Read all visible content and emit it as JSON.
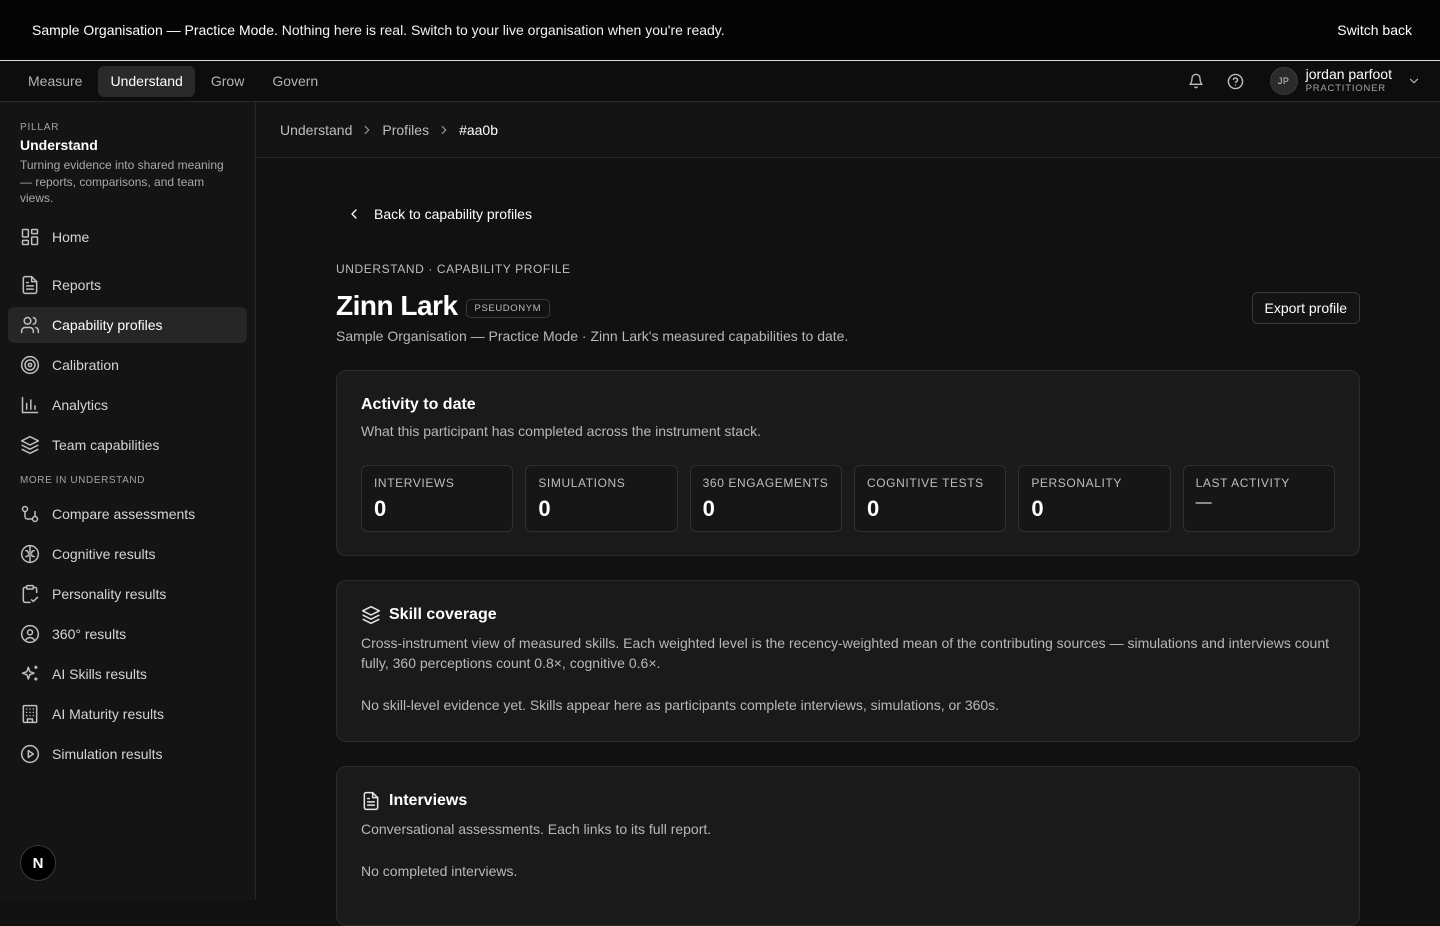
{
  "banner": {
    "org": "Sample Organisation — Practice Mode.",
    "message": "Nothing here is real. Switch to your live organisation when you're ready.",
    "switch_label": "Switch back"
  },
  "topnav": {
    "pillars": [
      {
        "label": "Measure"
      },
      {
        "label": "Understand",
        "active": true
      },
      {
        "label": "Grow"
      },
      {
        "label": "Govern"
      }
    ],
    "icons": [
      "bell-icon",
      "help-icon",
      "chevron-down-icon"
    ],
    "user": {
      "initials": "JP",
      "name": "jordan parfoot",
      "role": "PRACTITIONER"
    }
  },
  "sidebar": {
    "pillar_label": "PILLAR",
    "pillar_title": "Understand",
    "pillar_desc": "Turning evidence into shared meaning — reports, comparisons, and team views.",
    "items": [
      {
        "label": "Home",
        "icon": "dashboard-icon"
      },
      {
        "label": "Reports",
        "icon": "document-icon"
      },
      {
        "label": "Capability profiles",
        "icon": "users-icon",
        "active": true
      },
      {
        "label": "Calibration",
        "icon": "target-icon"
      },
      {
        "label": "Analytics",
        "icon": "bar-chart-icon"
      },
      {
        "label": "Team capabilities",
        "icon": "layers-icon"
      }
    ],
    "more_label": "MORE IN UNDERSTAND",
    "more_items": [
      {
        "label": "Compare assessments",
        "icon": "compare-icon"
      },
      {
        "label": "Cognitive results",
        "icon": "brain-icon"
      },
      {
        "label": "Personality results",
        "icon": "clipboard-icon"
      },
      {
        "label": "360° results",
        "icon": "user-circle-icon"
      },
      {
        "label": "AI Skills results",
        "icon": "sparkles-icon"
      },
      {
        "label": "AI Maturity results",
        "icon": "building-icon"
      },
      {
        "label": "Simulation results",
        "icon": "play-circle-icon"
      }
    ],
    "logo_letter": "N"
  },
  "breadcrumb": {
    "items": [
      "Understand",
      "Profiles"
    ],
    "current": "#aa0b"
  },
  "profile": {
    "back_label": "Back to capability profiles",
    "eyebrow": "UNDERSTAND · CAPABILITY PROFILE",
    "name": "Zinn Lark",
    "badge": "PSEUDONYM",
    "subtitle": "Sample Organisation — Practice Mode · Zinn Lark's measured capabilities to date.",
    "export_label": "Export profile"
  },
  "activity": {
    "title": "Activity to date",
    "desc": "What this participant has completed across the instrument stack.",
    "stats": [
      {
        "label": "INTERVIEWS",
        "value": "0"
      },
      {
        "label": "SIMULATIONS",
        "value": "0"
      },
      {
        "label": "360 ENGAGEMENTS",
        "value": "0"
      },
      {
        "label": "COGNITIVE TESTS",
        "value": "0"
      },
      {
        "label": "PERSONALITY",
        "value": "0"
      },
      {
        "label": "LAST ACTIVITY",
        "value": "—"
      }
    ]
  },
  "skills": {
    "title": "Skill coverage",
    "desc": "Cross-instrument view of measured skills. Each weighted level is the recency-weighted mean of the contributing sources — simulations and interviews count fully, 360 perceptions count 0.8×, cognitive 0.6×.",
    "empty": "No skill-level evidence yet. Skills appear here as participants complete interviews, simulations, or 360s."
  },
  "interviews": {
    "title": "Interviews",
    "desc": "Conversational assessments. Each links to its full report.",
    "empty": "No completed interviews."
  }
}
